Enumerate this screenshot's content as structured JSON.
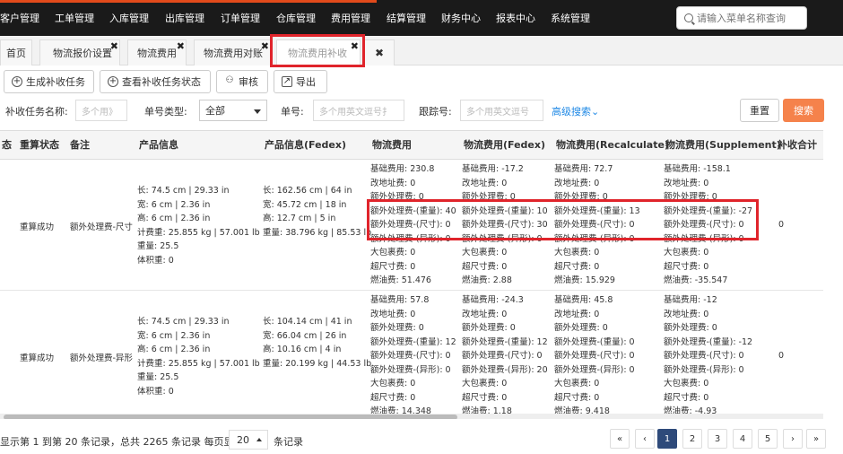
{
  "nav": {
    "items": [
      "客户管理",
      "工单管理",
      "入库管理",
      "出库管理",
      "订单管理",
      "仓库管理",
      "费用管理",
      "结算管理",
      "财务中心",
      "报表中心",
      "系统管理"
    ],
    "search_placeholder": "请输入菜单名称查询"
  },
  "tabs": [
    {
      "label": "首页"
    },
    {
      "label": "物流报价设置"
    },
    {
      "label": "物流费用"
    },
    {
      "label": "物流费用对账"
    },
    {
      "label": "物流费用补收"
    }
  ],
  "toolbar": {
    "generate": "生成补收任务",
    "view_status": "查看补收任务状态",
    "review": "审核",
    "export": "导出"
  },
  "filter": {
    "task_name_label": "补收任务名称:",
    "task_name_placeholder": "多个用》",
    "number_type_label": "单号类型:",
    "number_type_value": "全部",
    "number_label": "单号:",
    "number_placeholder": "多个用英文逗号扌",
    "tracking_label": "跟踪号:",
    "tracking_placeholder": "多个用英文逗号",
    "advanced": "高级搜索",
    "reset": "重置",
    "search": "搜索"
  },
  "table": {
    "headers": [
      "态",
      "重算状态",
      "备注",
      "产品信息",
      "产品信息(Fedex)",
      "物流费用",
      "物流费用(Fedex)",
      "物流费用(Recalculate)",
      "物流费用(Supplement)",
      "补收合计"
    ],
    "rows": [
      {
        "status": "重算成功",
        "remark": "额外处理费-尺寸",
        "product": [
          "长: 74.5 cm | 29.33 in",
          "宽: 6 cm | 2.36 in",
          "高: 6 cm | 2.36 in",
          "计费重: 25.855 kg | 57.001 lb",
          "重量: 25.5",
          "体积重: 0"
        ],
        "product_fedex": [
          "长: 162.56 cm | 64 in",
          "宽: 45.72 cm | 18 in",
          "高: 12.7 cm | 5 in",
          "重量: 38.796 kg | 85.53 lb"
        ],
        "fee": [
          "基础费用: 230.8",
          "改地址费: 0",
          "额外处理费: 0",
          "额外处理费-(重量): 40",
          "额外处理费-(尺寸): 0",
          "额外处理费-(异形): 0",
          "大包裹费: 0",
          "超尺寸费: 0",
          "燃油费: 51.476"
        ],
        "fee_fedex": [
          "基础费用: -17.2",
          "改地址费: 0",
          "额外处理费: 0",
          "额外处理费-(重量): 10",
          "额外处理费-(尺寸): 30",
          "额外处理费-(异形): 0",
          "大包裹费: 0",
          "超尺寸费: 0",
          "燃油费: 2.88"
        ],
        "fee_recalc": [
          "基础费用: 72.7",
          "改地址费: 0",
          "额外处理费: 0",
          "额外处理费-(重量): 13",
          "额外处理费-(尺寸): 0",
          "额外处理费-(异形): 0",
          "大包裹费: 0",
          "超尺寸费: 0",
          "燃油费: 15.929"
        ],
        "fee_supp": [
          "基础费用: -158.1",
          "改地址费: 0",
          "额外处理费: 0",
          "额外处理费-(重量): -27",
          "额外处理费-(尺寸): 0",
          "额外处理费-(异形): 0",
          "大包裹费: 0",
          "超尺寸费: 0",
          "燃油费: -35.547"
        ],
        "total": "0"
      },
      {
        "status": "重算成功",
        "remark": "额外处理费-异形",
        "product": [
          "长: 74.5 cm | 29.33 in",
          "宽: 6 cm | 2.36 in",
          "高: 6 cm | 2.36 in",
          "计费重: 25.855 kg | 57.001 lb",
          "重量: 25.5",
          "体积重: 0"
        ],
        "product_fedex": [
          "长: 104.14 cm | 41 in",
          "宽: 66.04 cm | 26 in",
          "高: 10.16 cm | 4 in",
          "重量: 20.199 kg | 44.53 lb"
        ],
        "fee": [
          "基础费用: 57.8",
          "改地址费: 0",
          "额外处理费: 0",
          "额外处理费-(重量): 12",
          "额外处理费-(尺寸): 0",
          "额外处理费-(异形): 0",
          "大包裹费: 0",
          "超尺寸费: 0",
          "燃油费: 14.348"
        ],
        "fee_fedex": [
          "基础费用: -24.3",
          "改地址费: 0",
          "额外处理费: 0",
          "额外处理费-(重量): 12",
          "额外处理费-(尺寸): 0",
          "额外处理费-(异形): 20",
          "大包裹费: 0",
          "超尺寸费: 0",
          "燃油费: 1.18"
        ],
        "fee_recalc": [
          "基础费用: 45.8",
          "改地址费: 0",
          "额外处理费: 0",
          "额外处理费-(重量): 0",
          "额外处理费-(尺寸): 0",
          "额外处理费-(异形): 0",
          "大包裹费: 0",
          "超尺寸费: 0",
          "燃油费: 9.418"
        ],
        "fee_supp": [
          "基础费用: -12",
          "改地址费: 0",
          "额外处理费: 0",
          "额外处理费-(重量): -12",
          "额外处理费-(尺寸): 0",
          "额外处理费-(异形): 0",
          "大包裹费: 0",
          "超尺寸费: 0",
          "燃油费: -4.93"
        ],
        "total": "0"
      }
    ]
  },
  "footer": {
    "summary": "显示第 1 到第 20 条记录，总共 2265 条记录 每页显示",
    "page_size": "20",
    "suffix": "条记录",
    "pages": [
      "«",
      "‹",
      "1",
      "2",
      "3",
      "4",
      "5",
      "›",
      "»"
    ],
    "current_page": "1"
  },
  "colors": {
    "nav_bg": "#1a1a1a",
    "search_btn": "#f5824b",
    "highlight": "#e0242b",
    "current_page": "#2e4a7a"
  }
}
